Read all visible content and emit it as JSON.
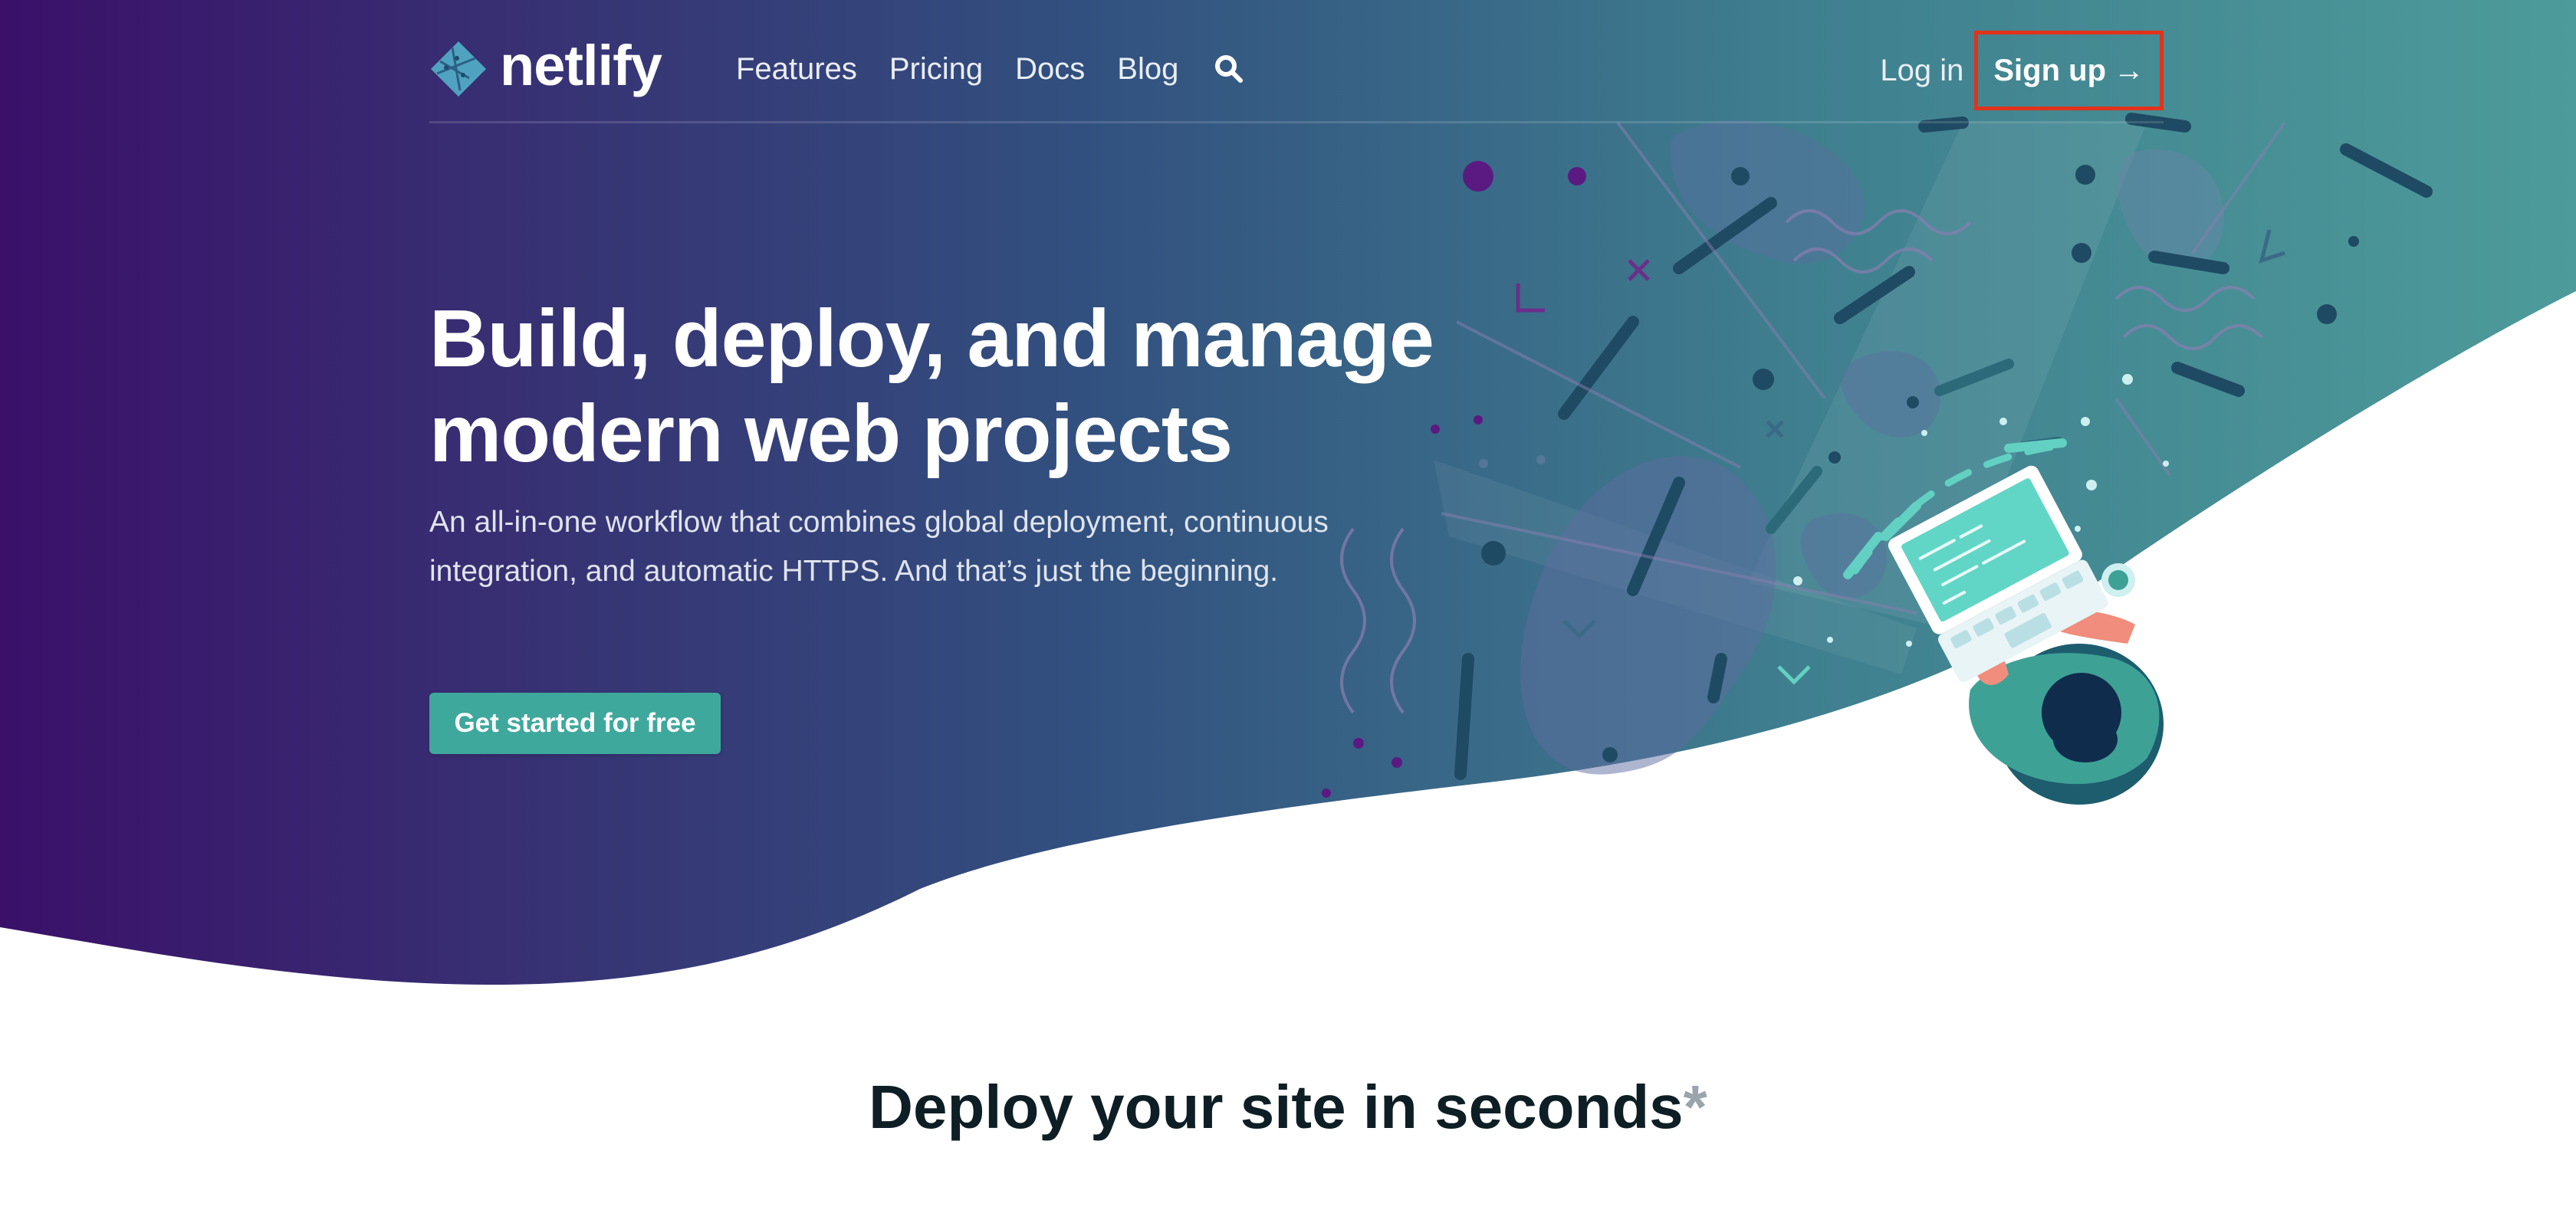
{
  "colors": {
    "gradient_left": "#3a1069",
    "gradient_mid": "#33517f",
    "gradient_right": "#4d9b9a",
    "accent_teal": "#3fa89c",
    "highlight_red": "#e0331c",
    "section_title": "#0e1e25"
  },
  "brand": {
    "name": "netlify",
    "logo_icon": "netlify-logo-icon"
  },
  "nav": {
    "links": [
      {
        "label": "Features"
      },
      {
        "label": "Pricing"
      },
      {
        "label": "Docs"
      },
      {
        "label": "Blog"
      }
    ],
    "search_icon": "search-icon",
    "login_label": "Log in",
    "signup_label": "Sign up",
    "signup_arrow": "→"
  },
  "hero": {
    "title_line1": "Build, deploy, and manage",
    "title_line2": "modern web projects",
    "subtitle": "An all-in-one workflow that combines global deployment, continuous integration, and automatic HTTPS. And that’s just the beginning.",
    "cta_label": "Get started for free",
    "illustration": "developer-at-laptop-illustration"
  },
  "section": {
    "title": "Deploy your site in seconds",
    "asterisk": "*"
  }
}
